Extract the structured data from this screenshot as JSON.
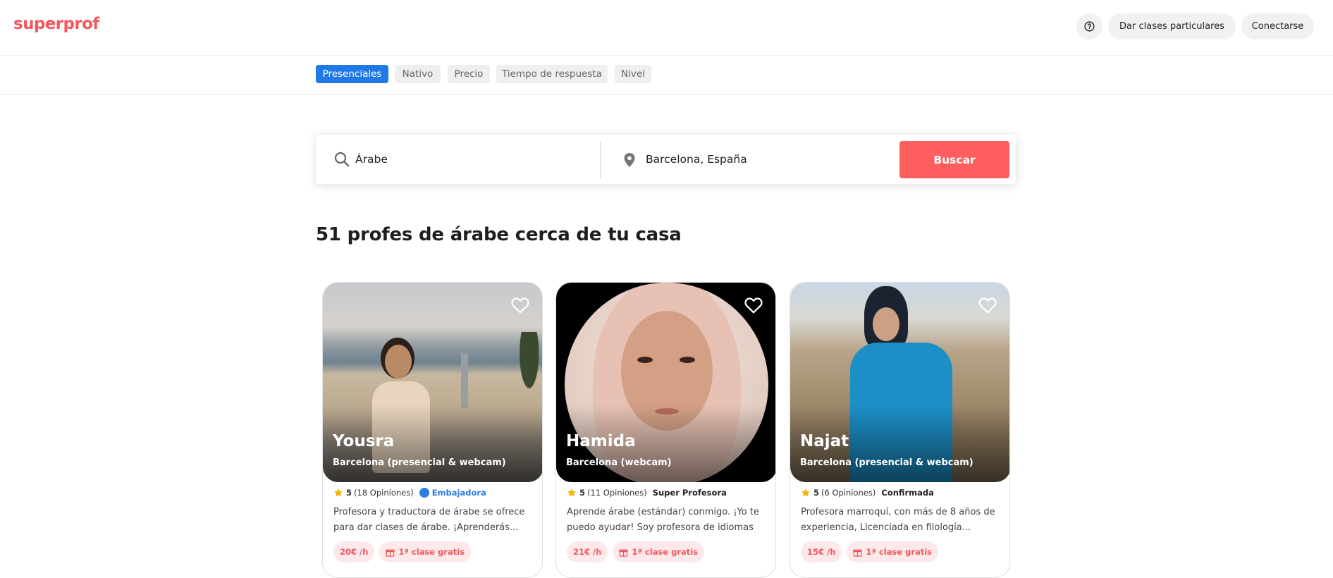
{
  "colors": {
    "brand": "#f1575f",
    "active_chip": "#2179e6",
    "button_red": "#ff5e5e",
    "badge_blue": "#2f7de1",
    "star": "#f5b400"
  },
  "header": {
    "logo": "superprof",
    "help_icon": "question-circle-icon",
    "give_classes_label": "Dar clases particulares",
    "login_label": "Conectarse"
  },
  "filters": [
    {
      "label": "Presenciales",
      "active": true
    },
    {
      "label": "Nativo",
      "active": false
    },
    {
      "label": "Precio",
      "active": false
    },
    {
      "label": "Tiempo de respuesta",
      "active": false
    },
    {
      "label": "Nivel",
      "active": false
    }
  ],
  "search": {
    "subject_value": "Árabe",
    "location_value": "Barcelona, España",
    "button_label": "Buscar"
  },
  "results_title": "51 profes de árabe cerca de tu casa",
  "teachers": [
    {
      "name": "Yousra",
      "location": "Barcelona (presencial & webcam)",
      "rating": "5",
      "reviews": "(18 Opiniones)",
      "badge": "Embajadora",
      "description_line1": "Profesora y traductora de árabe se ofrece",
      "description_line2": "para dar clases de árabe. ¡Aprenderás...",
      "price": "20€ /h",
      "free_class": "1ª clase gratis"
    },
    {
      "name": "Hamida",
      "location": "Barcelona (webcam)",
      "rating": "5",
      "reviews": "(11 Opiniones)",
      "badge": "Super Profesora",
      "description_line1": "Aprende árabe (estándar) conmigo. ¡Yo te",
      "description_line2": "puedo ayudar! Soy profesora de idiomas",
      "price": "21€ /h",
      "free_class": "1ª clase gratis"
    },
    {
      "name": "Najat",
      "location": "Barcelona (presencial & webcam)",
      "rating": "5",
      "reviews": "(6 Opiniones)",
      "badge": "Confirmada",
      "description_line1": "Profesora marroquí, con más de 8 años de",
      "description_line2": "experiencia, Licenciada en filología...",
      "price": "15€ /h",
      "free_class": "1ª clase gratis"
    }
  ]
}
